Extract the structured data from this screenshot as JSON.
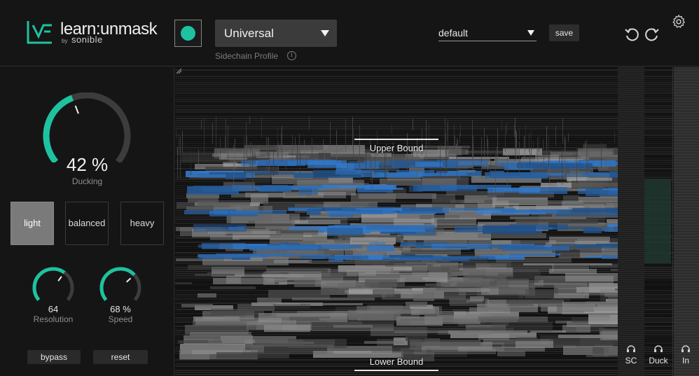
{
  "brand": {
    "name": "learn:unmask",
    "by": "by",
    "company": "sonible"
  },
  "header": {
    "sidechain_profile": {
      "value": "Universal",
      "caption": "Sidechain Profile",
      "led_color": "#1ec2a0"
    },
    "preset": {
      "value": "default",
      "save_label": "save"
    }
  },
  "controls": {
    "ducking": {
      "value": "42 %",
      "label": "Ducking",
      "level": 0.42
    },
    "modes": [
      {
        "label": "light",
        "active": true
      },
      {
        "label": "balanced",
        "active": false
      },
      {
        "label": "heavy",
        "active": false
      }
    ],
    "resolution": {
      "value": "64",
      "label": "Resolution",
      "level": 0.64
    },
    "speed": {
      "value": "68 %",
      "label": "Speed",
      "level": 0.68
    },
    "bypass_label": "bypass",
    "reset_label": "reset"
  },
  "spectrogram": {
    "upper_bound_label": "Upper Bound",
    "lower_bound_label": "Lower Bound",
    "monitors": [
      {
        "label": "SC"
      },
      {
        "label": "Duck"
      },
      {
        "label": "In"
      }
    ]
  },
  "colors": {
    "accent": "#1ec2a0",
    "spectrogram_blue": "#2f8fb8"
  }
}
